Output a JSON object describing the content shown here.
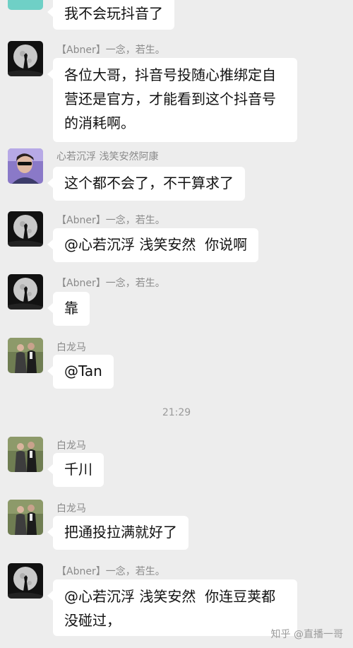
{
  "messages": [
    {
      "sender": "",
      "text": "我不会玩抖音了"
    },
    {
      "sender": "【Abner】一念，若生。",
      "text": "各位大哥，抖音号投随心推绑定自营还是官方，才能看到这个抖音号的消耗啊。"
    },
    {
      "sender": "心若沉浮 浅笑安然阿康",
      "text": "这个都不会了，不干算求了"
    },
    {
      "sender": "【Abner】一念，若生。",
      "text": "@心若沉浮 浅笑安然  你说啊"
    },
    {
      "sender": "【Abner】一念，若生。",
      "text": "靠"
    },
    {
      "sender": "白龙马",
      "text": "@Tan"
    },
    {
      "sender": "白龙马",
      "text": "千川"
    },
    {
      "sender": "白龙马",
      "text": "把通投拉满就好了"
    },
    {
      "sender": "【Abner】一念，若生。",
      "text": "@心若沉浮 浅笑安然  你连豆荚都没碰过，"
    }
  ],
  "lines": {
    "m2": [
      "各位大哥，抖音号投随心推绑定自",
      "营还是官方，才能看到这个抖音号",
      "的消耗啊。"
    ],
    "m9": [
      "@心若沉浮 浅笑安然  你连豆荚都",
      "没碰过，"
    ]
  },
  "timestamp": "21:29",
  "watermark": "知乎 @直播一哥",
  "colors": {
    "background": "#ededed",
    "bubble": "#ffffff",
    "name": "#8a8a8a"
  },
  "icons": {
    "abner": "moon-silhouette-avatar",
    "kang": "person-photo-avatar",
    "bailongma": "couple-photo-avatar"
  }
}
